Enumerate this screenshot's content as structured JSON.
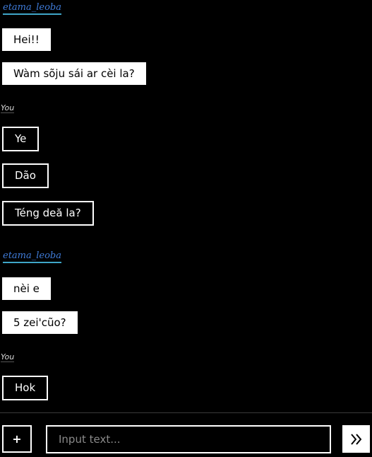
{
  "conversation": {
    "groups": [
      {
        "sender": "etama_leoba",
        "messages": [
          "Hei!!",
          "Wàm sõju sái ar cèi la?"
        ]
      },
      {
        "sender": "You",
        "messages": [
          "Ye",
          "Dão",
          "Téng deă la?"
        ]
      },
      {
        "sender": "etama_leoba",
        "messages": [
          "nèi e",
          "5 zei'cũo?"
        ]
      },
      {
        "sender": "You",
        "messages": [
          "Hok"
        ]
      }
    ]
  },
  "composer": {
    "plus_label": "+",
    "input_value": "",
    "input_placeholder": "Input text...",
    "send_icon": "double-chevron-right-icon"
  },
  "colors": {
    "background": "#000000",
    "incoming_bubble": "#ffffff",
    "outgoing_border": "#ffffff",
    "sender_name": "#3f7bd8",
    "sender_underline": "#3fa6c8"
  }
}
